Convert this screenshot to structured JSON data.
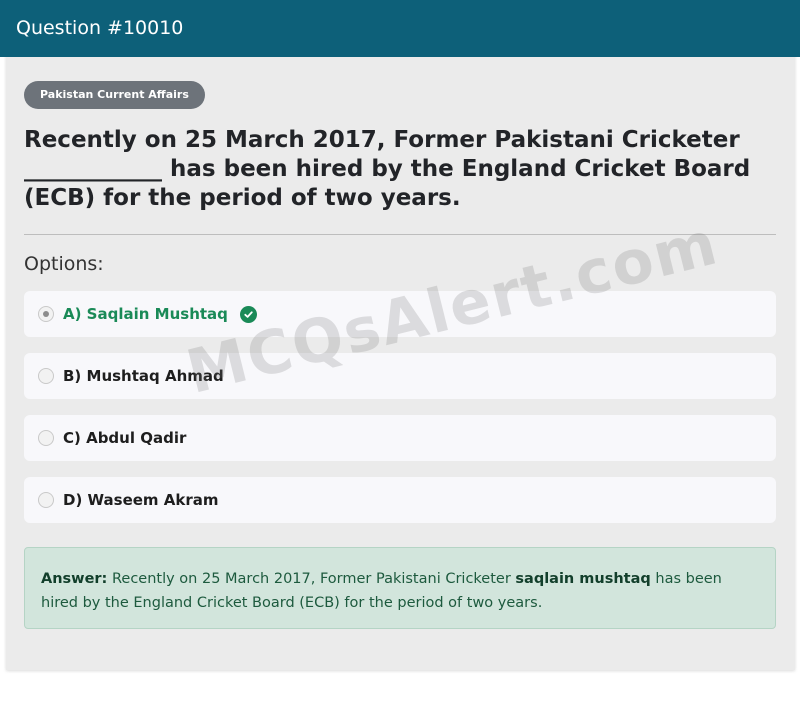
{
  "header": {
    "title": "Question #10010"
  },
  "category": {
    "label": "Pakistan Current Affairs"
  },
  "question": {
    "text": "Recently on 25 March 2017, Former Pakistani Cricketer ____________ has been hired by the England Cricket Board (ECB) for the period of two years."
  },
  "options_label": "Options:",
  "options": [
    {
      "label": "A) Saqlain Mushtaq",
      "selected": true,
      "correct": true
    },
    {
      "label": "B) Mushtaq Ahmad",
      "selected": false,
      "correct": false
    },
    {
      "label": "C) Abdul Qadir",
      "selected": false,
      "correct": false
    },
    {
      "label": "D) Waseem Akram",
      "selected": false,
      "correct": false
    }
  ],
  "answer": {
    "prefix": "Answer:",
    "text_before": "Recently on 25 March 2017, Former Pakistani Cricketer",
    "highlight": "saqlain mushtaq",
    "text_after": "has been hired by the England Cricket Board (ECB) for the period of two years."
  },
  "watermark": "MCQsAlert.com",
  "colors": {
    "header_bg": "#0d6079",
    "correct": "#1a8a57",
    "answer_bg": "#d2e5dc"
  },
  "icons": {
    "correct": "check-circle-icon"
  }
}
